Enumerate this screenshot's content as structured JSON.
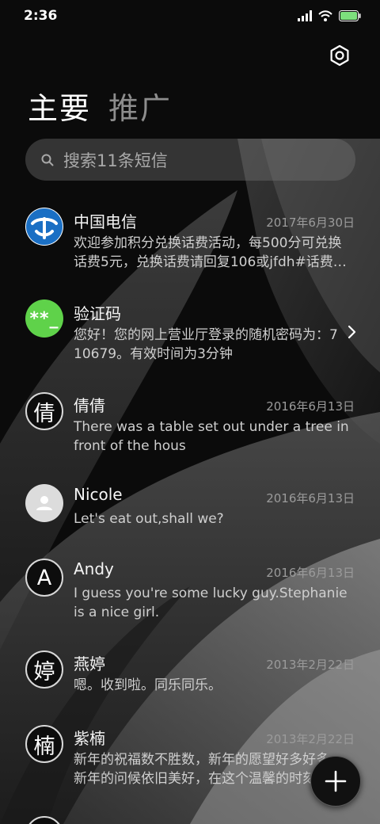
{
  "status_bar": {
    "time": "2:36",
    "icons": [
      "signal-icon",
      "wifi-icon",
      "battery-icon"
    ]
  },
  "header": {
    "tabs": [
      {
        "label": "主要",
        "active": true
      },
      {
        "label": "推广",
        "active": false
      }
    ],
    "settings_icon": "settings-icon"
  },
  "search": {
    "placeholder": "搜索11条短信",
    "icon": "search-icon"
  },
  "conversations": [
    {
      "name": "中国电信",
      "date": "2017年6月30日",
      "preview": "欢迎参加积分兑换话费活动，每500分可兑换话费5元，兑换话费请回复106或jfdh#话费…",
      "avatar": {
        "type": "brand",
        "icon": "china-telecom-logo",
        "color": "#1a6fc4"
      }
    },
    {
      "name": "验证码",
      "date": "",
      "preview": "您好！您的网上营业厅登录的随机密码为：710679。有效时间为3分钟",
      "avatar": {
        "type": "green",
        "text": "**_",
        "color": "#5fd24a"
      },
      "chevron": true
    },
    {
      "name": "倩倩",
      "date": "2016年6月13日",
      "preview": "There was a table set out under a tree in front of the hous",
      "avatar": {
        "type": "letter",
        "text": "倩"
      }
    },
    {
      "name": "Nicole",
      "date": "2016年6月13日",
      "preview": "Let's eat out,shall we?",
      "avatar": {
        "type": "gray",
        "icon": "person-icon"
      }
    },
    {
      "name": "Andy",
      "date": "2016年6月13日",
      "preview": "I guess you're some lucky guy.Stephanie is a nice girl.",
      "avatar": {
        "type": "letter",
        "text": "A"
      }
    },
    {
      "name": "燕婷",
      "date": "2013年2月22日",
      "preview": "嗯。收到啦。同乐同乐。",
      "avatar": {
        "type": "letter",
        "text": "婷"
      }
    },
    {
      "name": "紫楠",
      "date": "2013年2月22日",
      "preview": "新年的祝福数不胜数，新年的愿望好多好多，新年的问候依旧美好，在这个温馨的时刻",
      "avatar": {
        "type": "letter",
        "text": "楠"
      }
    }
  ],
  "fab": {
    "icon": "plus-icon"
  }
}
